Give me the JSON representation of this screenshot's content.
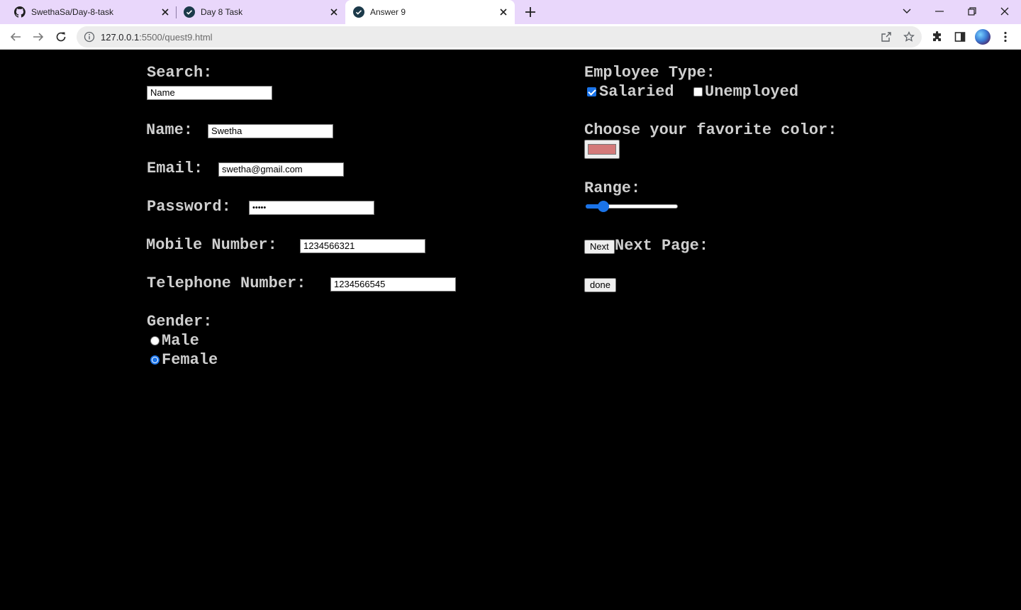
{
  "browser": {
    "tabs": [
      {
        "title": "SwethaSa/Day-8-task",
        "icon": "github-icon",
        "active": false
      },
      {
        "title": "Day 8 Task",
        "icon": "check-circle-icon",
        "active": false
      },
      {
        "title": "Answer 9",
        "icon": "check-circle-icon",
        "active": true
      }
    ],
    "url_host": "127.0.0.1",
    "url_rest": ":5500/quest9.html"
  },
  "form": {
    "search_label": "Search:",
    "search_value": "Name",
    "name_label": "Name:",
    "name_value": "Swetha",
    "email_label": "Email:",
    "email_value": "swetha@gmail.com",
    "password_label": "Password:",
    "password_value": "•••••",
    "mobile_label": "Mobile Number:",
    "mobile_value": "1234566321",
    "telephone_label": "Telephone Number:",
    "telephone_value": "1234566545",
    "gender_label": "Gender:",
    "gender_options": [
      {
        "label": "Male",
        "checked": false
      },
      {
        "label": "Female",
        "checked": true
      }
    ],
    "employee_type_label": "Employee Type:",
    "employee_options": [
      {
        "label": "Salaried",
        "checked": true
      },
      {
        "label": "Unemployed",
        "checked": false
      }
    ],
    "color_label": "Choose your favorite color:",
    "color_value": "#d47a7a",
    "range_label": "Range:",
    "range_fraction": 0.15,
    "next_button": "Next",
    "next_page_label": "Next Page:",
    "done_button": "done"
  },
  "colors": {
    "tabstrip": "#e9d7fb",
    "accent": "#1a73e8",
    "page_background": "#000000"
  }
}
